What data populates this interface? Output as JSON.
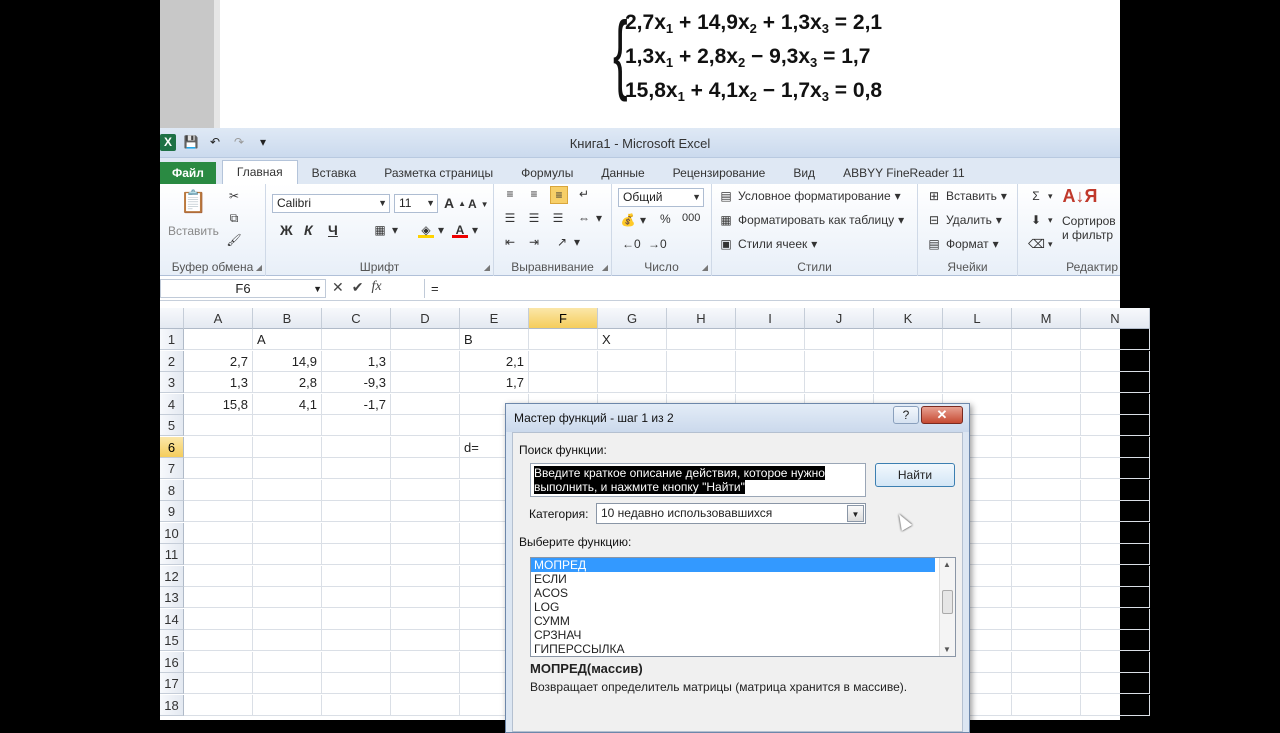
{
  "equations": [
    {
      "a1": "2,7",
      "a2": "14,9",
      "op2": "+",
      "a3": "1,3",
      "op3": "+",
      "rhs": "2,1"
    },
    {
      "a1": "1,3",
      "a2": "2,8",
      "op2": "+",
      "a3": "9,3",
      "op3": "−",
      "rhs": "1,7"
    },
    {
      "a1": "15,8",
      "a2": "4,1",
      "op2": "+",
      "a3": "1,7",
      "op3": "−",
      "rhs": "0,8"
    }
  ],
  "window": {
    "title": "Книга1  -  Microsoft Excel",
    "logo": "X"
  },
  "tabs": [
    "Файл",
    "Главная",
    "Вставка",
    "Разметка страницы",
    "Формулы",
    "Данные",
    "Рецензирование",
    "Вид",
    "ABBYY FineReader 11"
  ],
  "ribbon": {
    "clipboard": {
      "paste": "Вставить",
      "label": "Буфер обмена"
    },
    "font": {
      "name": "Calibri",
      "size": "11",
      "bold": "Ж",
      "italic": "К",
      "underline": "Ч",
      "label": "Шрифт"
    },
    "alignment": {
      "label": "Выравнивание"
    },
    "number": {
      "format": "Общий",
      "percent": "%",
      "thousands": "000",
      "label": "Число"
    },
    "styles": {
      "conditional": "Условное форматирование",
      "table": "Форматировать как таблицу",
      "cell_styles": "Стили ячеек",
      "label": "Стили"
    },
    "cells": {
      "insert": "Вставить",
      "delete": "Удалить",
      "format": "Формат",
      "label": "Ячейки"
    },
    "editing": {
      "sort": "Сортиров",
      "sort2": "и фильтр",
      "label": "Редактир"
    }
  },
  "formula_bar": {
    "name_box": "F6",
    "formula": "="
  },
  "columns": [
    "A",
    "B",
    "C",
    "D",
    "E",
    "F",
    "G",
    "H",
    "I",
    "J",
    "K",
    "L",
    "M",
    "N"
  ],
  "rows": [
    "1",
    "2",
    "3",
    "4",
    "5",
    "6",
    "7",
    "8",
    "9",
    "10",
    "11",
    "12",
    "13",
    "14",
    "15",
    "16",
    "17",
    "18"
  ],
  "cells": {
    "B1": "A",
    "E1": "B",
    "G1": "X",
    "A2": "2,7",
    "B2": "14,9",
    "C2": "1,3",
    "E2": "2,1",
    "A3": "1,3",
    "B3": "2,8",
    "C3": "-9,3",
    "E3": "1,7",
    "A4": "15,8",
    "B4": "4,1",
    "C4": "-1,7",
    "E6": "d="
  },
  "dialog": {
    "title": "Мастер функций - шаг 1 из 2",
    "help": "?",
    "close": "✕",
    "search_label": "Поиск функции:",
    "search_text": "Введите краткое описание действия, которое нужно выполнить, и нажмите кнопку \"Найти\"",
    "find_button": "Найти",
    "category_label": "Категория:",
    "category_value": "10 недавно использовавшихся",
    "select_label": "Выберите функцию:",
    "functions": [
      "МОПРЕД",
      "ЕСЛИ",
      "ACOS",
      "LOG",
      "СУММ",
      "СРЗНАЧ",
      "ГИПЕРССЫЛКА"
    ],
    "signature": "МОПРЕД(массив)",
    "description": "Возвращает определитель матрицы (матрица хранится в массиве)."
  }
}
